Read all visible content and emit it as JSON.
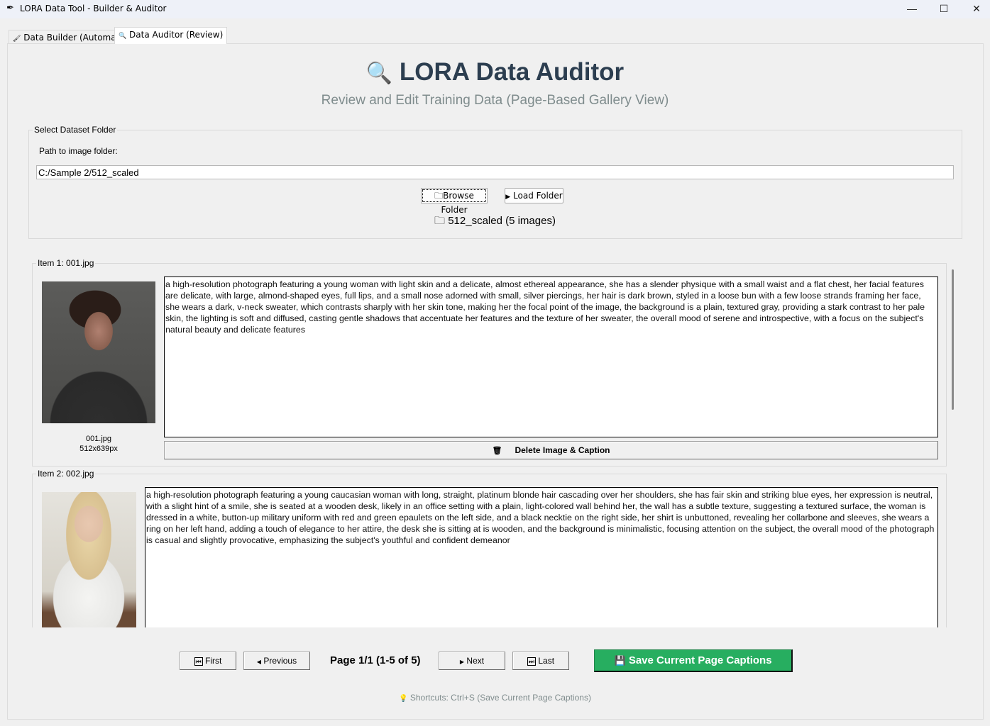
{
  "window": {
    "title": "LORA Data Tool - Builder & Auditor",
    "minimize": "—",
    "maximize": "☐",
    "close": "✕"
  },
  "tabs": [
    {
      "label": "Data Builder (Automate)",
      "icon": "🖌"
    },
    {
      "label": "Data Auditor (Review)",
      "icon": "🔍"
    }
  ],
  "header": {
    "title": "LORA Data Auditor",
    "subtitle": "Review and Edit Training Data (Page-Based Gallery View)",
    "icon": "🔍"
  },
  "dataset": {
    "group_label": "Select Dataset Folder",
    "path_label": "Path to image folder:",
    "path_value": "C:/Sample 2/512_scaled",
    "browse_label": "Browse Folder",
    "load_label": "Load Folder",
    "folder_info": "512_scaled (5 images)"
  },
  "items": [
    {
      "label": "Item 1: 001.jpg",
      "filename": "001.jpg",
      "dims": "512x639px",
      "caption": "a high-resolution photograph featuring a young woman with light skin and a delicate, almost ethereal appearance, she has a slender physique with a small waist and a flat chest, her facial features are delicate, with large, almond-shaped eyes, full lips, and a small nose adorned with small, silver piercings, her hair is dark brown, styled in a loose bun with a few loose strands framing her face, she wears a dark, v-neck sweater, which contrasts sharply with her skin tone, making her the focal point of the image, the background is a plain, textured gray, providing a stark contrast to her pale skin, the lighting is soft and diffused, casting gentle shadows that accentuate her features and the texture of her sweater, the overall mood of serene and introspective, with a focus on the subject's natural beauty and delicate features",
      "delete_label": "Delete Image & Caption"
    },
    {
      "label": "Item 2: 002.jpg",
      "caption": "a high-resolution photograph featuring a young caucasian woman with long, straight, platinum blonde hair cascading over her shoulders, she has fair skin and striking blue eyes, her expression is neutral, with a slight hint of a smile, she is seated at a wooden desk, likely in an office setting with a plain, light-colored wall behind her, the wall has a subtle texture, suggesting a textured surface, the woman is dressed in a white, button-up military uniform with red and green epaulets on the left side, and a black necktie on the right side, her shirt is unbuttoned, revealing her collarbone and sleeves, she wears a ring on her left hand, adding a touch of elegance to her attire, the desk she is sitting at is wooden, and the background is minimalistic, focusing attention on the subject, the overall mood of the photograph is casual and slightly provocative, emphasizing the subject's youthful and confident demeanor"
    }
  ],
  "pagination": {
    "first": "First",
    "previous": "Previous",
    "page_info": "Page 1/1 (1-5 of 5)",
    "next": "Next",
    "last": "Last",
    "save": "Save Current Page Captions"
  },
  "shortcuts": "Shortcuts: Ctrl+S (Save Current Page Captions)",
  "colors": {
    "save_bg": "#27ae60",
    "title": "#2c3e50",
    "subtitle": "#7f8c8d"
  }
}
